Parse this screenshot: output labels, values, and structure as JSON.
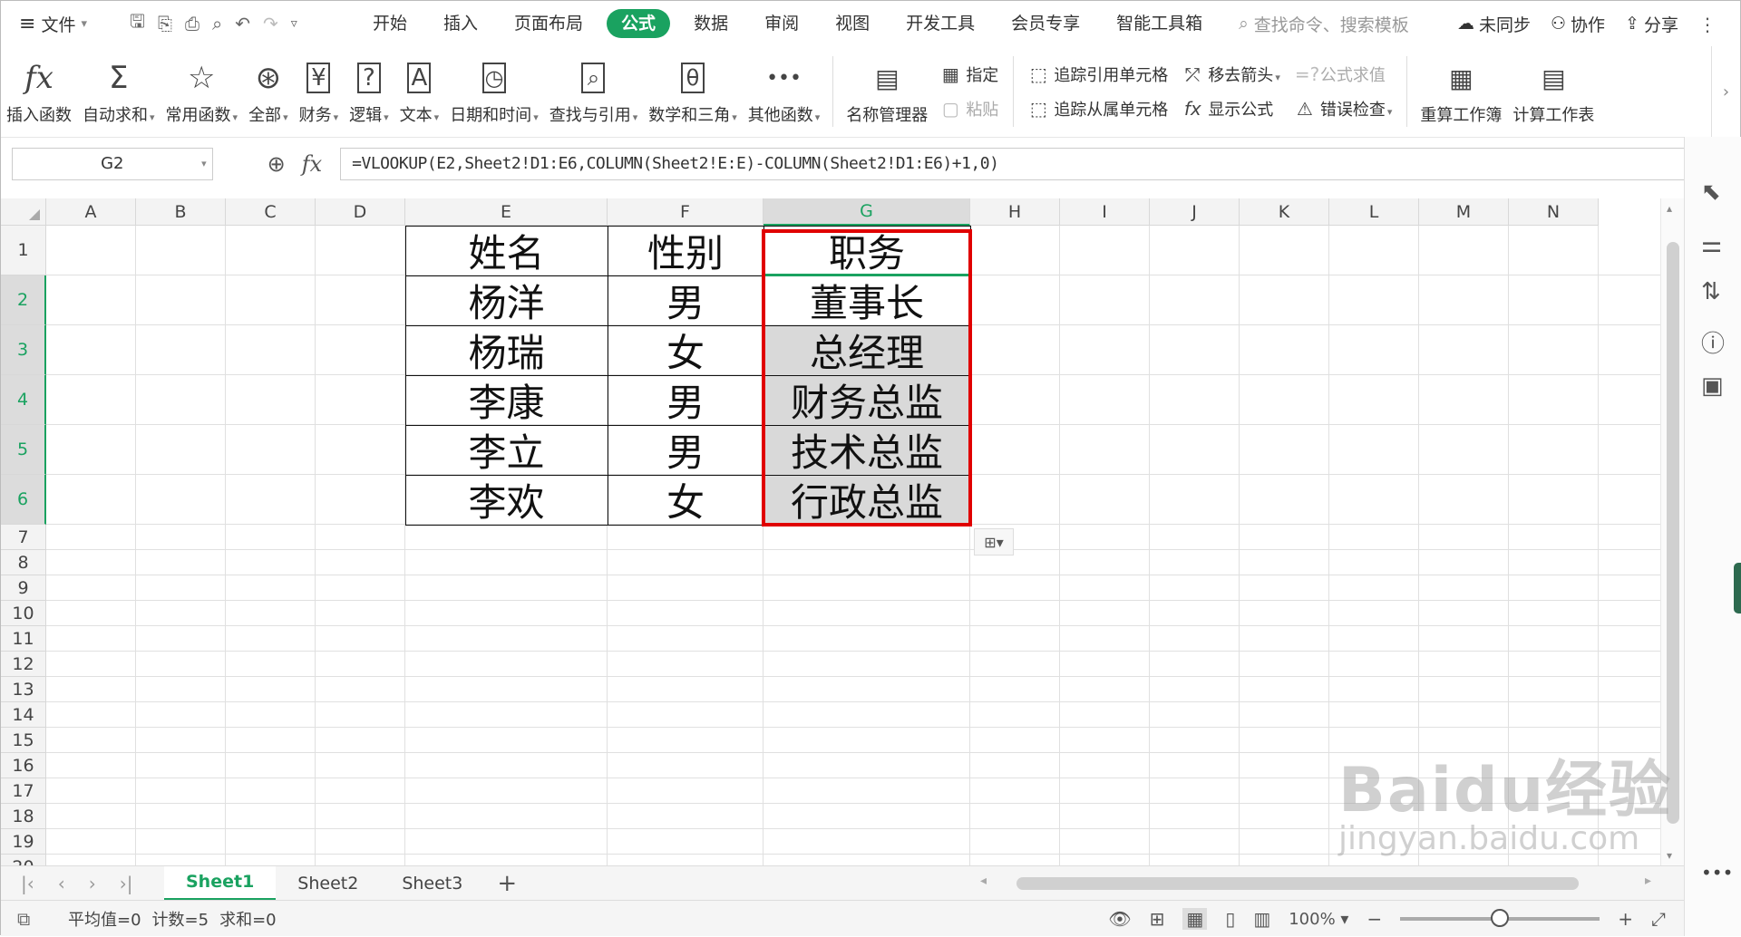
{
  "menubar": {
    "file_label": "文件",
    "tabs": [
      "开始",
      "插入",
      "页面布局",
      "公式",
      "数据",
      "审阅",
      "视图",
      "开发工具",
      "会员专享",
      "智能工具箱"
    ],
    "active_tab": "公式",
    "search_placeholder": "查找命令、搜索模板",
    "sync_label": "未同步",
    "collab_label": "协作",
    "share_label": "分享"
  },
  "ribbon": {
    "insert_function": "插入函数",
    "autosum": "自动求和",
    "common_functions": "常用函数",
    "all": "全部",
    "finance": "财务",
    "logic": "逻辑",
    "text": "文本",
    "datetime": "日期和时间",
    "lookup": "查找与引用",
    "math": "数学和三角",
    "other": "其他函数",
    "name_manager": "名称管理器",
    "define": "指定",
    "paste": "粘贴",
    "trace_precedents": "追踪引用单元格",
    "trace_dependents": "追踪从属单元格",
    "remove_arrows": "移去箭头",
    "show_formulas": "显示公式",
    "evaluate": "公式求值",
    "error_check": "错误检查",
    "recalc_workbook": "重算工作簿",
    "calc_sheet": "计算工作表"
  },
  "formula_bar": {
    "name_box": "G2",
    "formula": "=VLOOKUP(E2,Sheet2!D1:E6,COLUMN(Sheet2!E:E)-COLUMN(Sheet2!D1:E6)+1,0)"
  },
  "grid": {
    "columns": [
      "A",
      "B",
      "C",
      "D",
      "E",
      "F",
      "G",
      "H",
      "I",
      "J",
      "K",
      "L",
      "M",
      "N"
    ],
    "rows": [
      "1",
      "2",
      "3",
      "4",
      "5",
      "6",
      "7",
      "8",
      "9",
      "10",
      "11",
      "12",
      "13",
      "14",
      "15",
      "16",
      "17",
      "18",
      "19",
      "20"
    ],
    "selected_column": "G",
    "table": [
      [
        "姓名",
        "性别",
        "职务"
      ],
      [
        "杨洋",
        "男",
        "董事长"
      ],
      [
        "杨瑞",
        "女",
        "总经理"
      ],
      [
        "李康",
        "男",
        "财务总监"
      ],
      [
        "李立",
        "男",
        "技术总监"
      ],
      [
        "李欢",
        "女",
        "行政总监"
      ]
    ]
  },
  "sheets": [
    "Sheet1",
    "Sheet2",
    "Sheet3"
  ],
  "active_sheet": "Sheet1",
  "status": {
    "average": "平均值=0",
    "count": "计数=5",
    "sum": "求和=0",
    "zoom": "100%"
  },
  "watermark": {
    "main": "Baidu经验",
    "url": "jingyan.baidu.com"
  },
  "colors": {
    "accent": "#1aa260",
    "selection_outline": "#e00000"
  }
}
